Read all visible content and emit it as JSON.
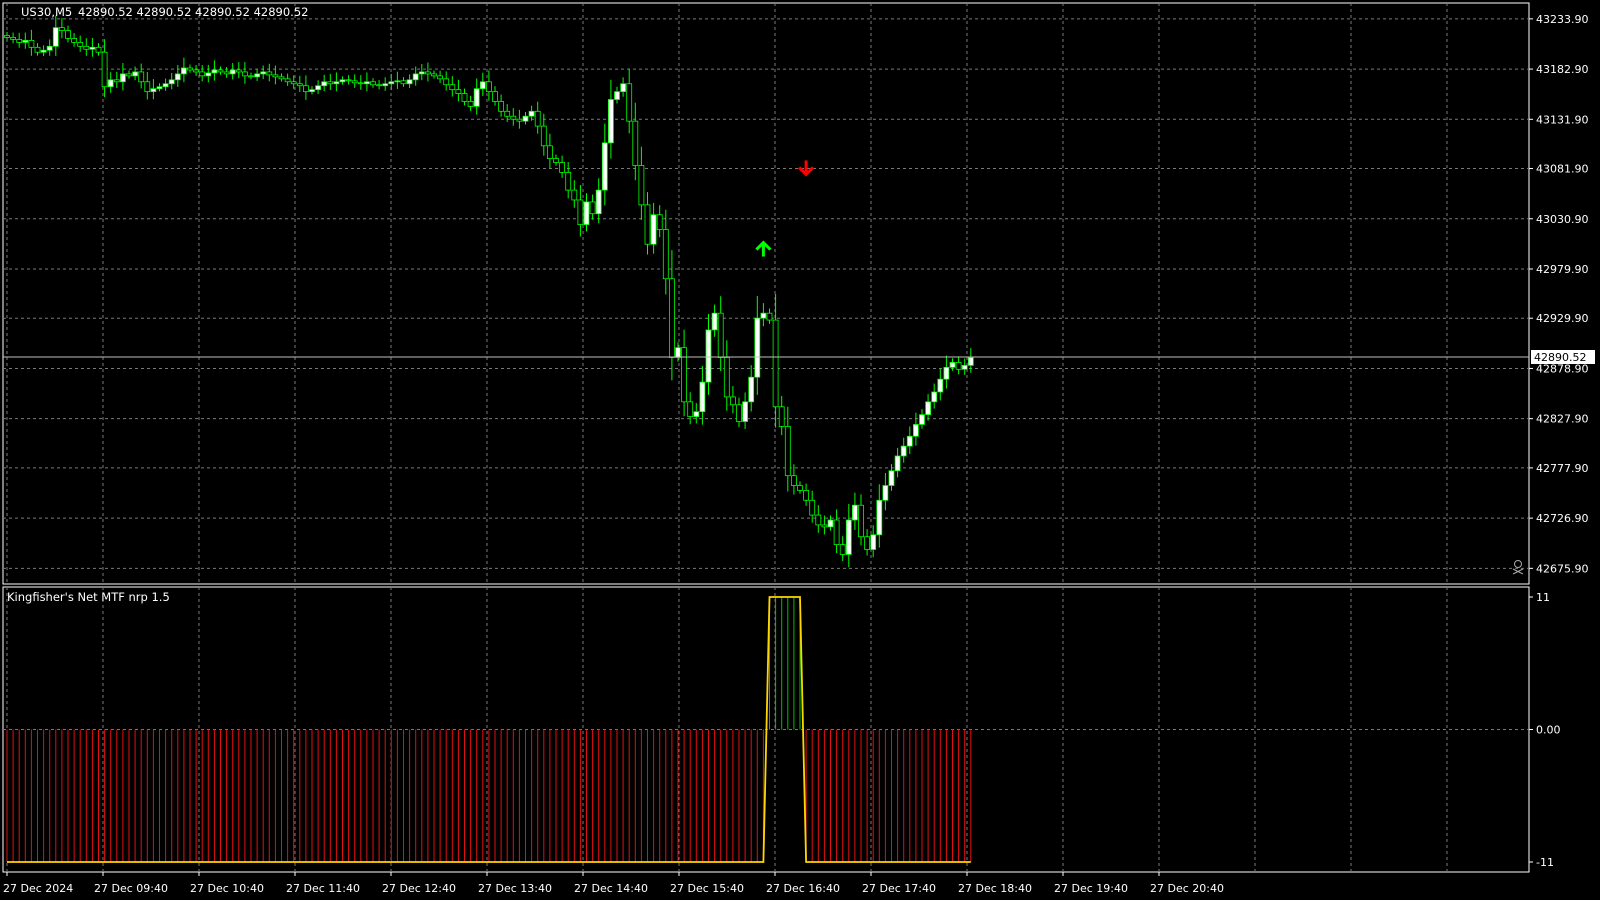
{
  "header": {
    "symbol": "US30,M5",
    "ohlc": "42890.52 42890.52 42890.52 42890.52"
  },
  "colors": {
    "background": "#000000",
    "grid": "#7a7a7a",
    "bull_candle": "#ffffff",
    "bear_candle": "#000000",
    "candle_outline": "#00ff00",
    "buy_arrow": "#00ff00",
    "sell_arrow": "#ff0000",
    "price_line": "#c0c0c0",
    "osc_line": "#ffd700",
    "osc_neg_hist": "#e01010",
    "osc_pos_hist": "#00c000"
  },
  "price_axis": {
    "ticks": [
      "43233.90",
      "43182.90",
      "43131.90",
      "43081.90",
      "43030.90",
      "42979.90",
      "42929.90",
      "42878.90",
      "42827.90",
      "42777.90",
      "42726.90",
      "42675.90"
    ],
    "current_price_label": "42890.52"
  },
  "indicator": {
    "title": "Kingfisher's Net MTF nrp 1.5",
    "axis_ticks": [
      "11",
      "0.00",
      "-11"
    ]
  },
  "time_axis": {
    "labels": [
      "27 Dec 2024",
      "27 Dec 09:40",
      "27 Dec 10:40",
      "27 Dec 11:40",
      "27 Dec 12:40",
      "27 Dec 13:40",
      "27 Dec 14:40",
      "27 Dec 15:40",
      "27 Dec 16:40",
      "27 Dec 17:40",
      "27 Dec 18:40",
      "27 Dec 19:40",
      "27 Dec 20:40"
    ]
  },
  "chart_data": [
    {
      "type": "candlestick",
      "title": "US30,M5",
      "ylim": [
        42660,
        43250
      ],
      "current_price": 42890.52,
      "signals": [
        {
          "type": "buy",
          "bar": 124,
          "price": 43025
        },
        {
          "type": "sell",
          "bar": 131,
          "price": 43082
        }
      ],
      "closes": [
        43215,
        43213,
        43210,
        43212,
        43205,
        43200,
        43202,
        43206,
        43225,
        43222,
        43214,
        43210,
        43206,
        43203,
        43205,
        43200,
        43165,
        43172,
        43170,
        43178,
        43176,
        43180,
        43170,
        43160,
        43163,
        43165,
        43168,
        43172,
        43178,
        43184,
        43182,
        43180,
        43176,
        43179,
        43182,
        43180,
        43178,
        43182,
        43180,
        43176,
        43175,
        43178,
        43180,
        43177,
        43175,
        43173,
        43170,
        43168,
        43166,
        43160,
        43162,
        43166,
        43170,
        43168,
        43170,
        43172,
        43171,
        43169,
        43168,
        43170,
        43167,
        43166,
        43168,
        43170,
        43171,
        43168,
        43172,
        43178,
        43180,
        43178,
        43176,
        43173,
        43167,
        43162,
        43158,
        43150,
        43145,
        43163,
        43170,
        43160,
        43150,
        43140,
        43135,
        43132,
        43130,
        43135,
        43140,
        43125,
        43105,
        43092,
        43088,
        43078,
        43060,
        43050,
        43025,
        43048,
        43036,
        43060,
        43108,
        43152,
        43160,
        43168,
        43130,
        43085,
        43045,
        43005,
        43035,
        43020,
        42970,
        42890,
        42900,
        42845,
        42830,
        42835,
        42865,
        42918,
        42935,
        42890,
        42850,
        42842,
        42825,
        42845,
        42870,
        42930,
        42935,
        42928,
        42840,
        42820,
        42770,
        42760,
        42755,
        42745,
        42730,
        42720,
        42718,
        42725,
        42700,
        42690,
        42725,
        42740,
        42708,
        42695,
        42710,
        42745,
        42760,
        42775,
        42790,
        42800,
        42810,
        42822,
        42832,
        42845,
        42855,
        42868,
        42880,
        42885,
        42878,
        42882,
        42890
      ],
      "x_labels": [
        "27 Dec 2024",
        "27 Dec 09:40",
        "27 Dec 10:40",
        "27 Dec 11:40",
        "27 Dec 12:40",
        "27 Dec 13:40",
        "27 Dec 14:40",
        "27 Dec 15:40",
        "27 Dec 16:40",
        "27 Dec 17:40",
        "27 Dec 18:40",
        "27 Dec 19:40",
        "27 Dec 20:40"
      ]
    },
    {
      "type": "bar",
      "title": "Kingfisher's Net MTF nrp 1.5",
      "ylim": [
        -11,
        11
      ],
      "values_rule": "all bars -11 except bars 125-130 which are +11",
      "positive_bars": [
        125,
        130
      ],
      "low_value": -11,
      "high_value": 11
    }
  ]
}
